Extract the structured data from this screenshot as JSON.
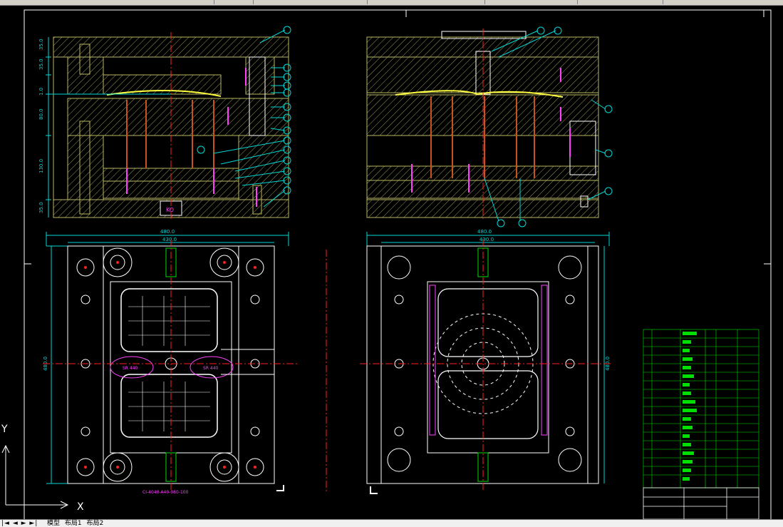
{
  "drawing": {
    "dimensions": {
      "side_top_left": "480.0",
      "side_inner_left": "430.0",
      "height_left": "480.0",
      "side_top_right": "480.0",
      "side_inner_right": "430.0",
      "height_right": "480.0"
    },
    "vertical_dims": [
      "35.0",
      "35.0",
      "1.0",
      "80.0",
      "130.0",
      "35.0"
    ],
    "labels": {
      "ko": "KO",
      "part_note": "SR 440",
      "spec": "CI-4040-A40-080-100"
    },
    "ucs": {
      "x": "X",
      "y": "Y"
    }
  },
  "statusbar": {
    "nav": "|◄ ◄ ► ►|",
    "tabs": [
      "模型",
      "布局1",
      "布局2"
    ]
  },
  "colors": {
    "background": "#000000",
    "plate_line": "#b8b860",
    "dimension": "#00d8d8",
    "centerline": "#ff2020",
    "ejector": "#ff40ff",
    "white": "#ffffff",
    "green": "#00e000",
    "yellow": "#ffff40",
    "brown": "#c8541c"
  }
}
